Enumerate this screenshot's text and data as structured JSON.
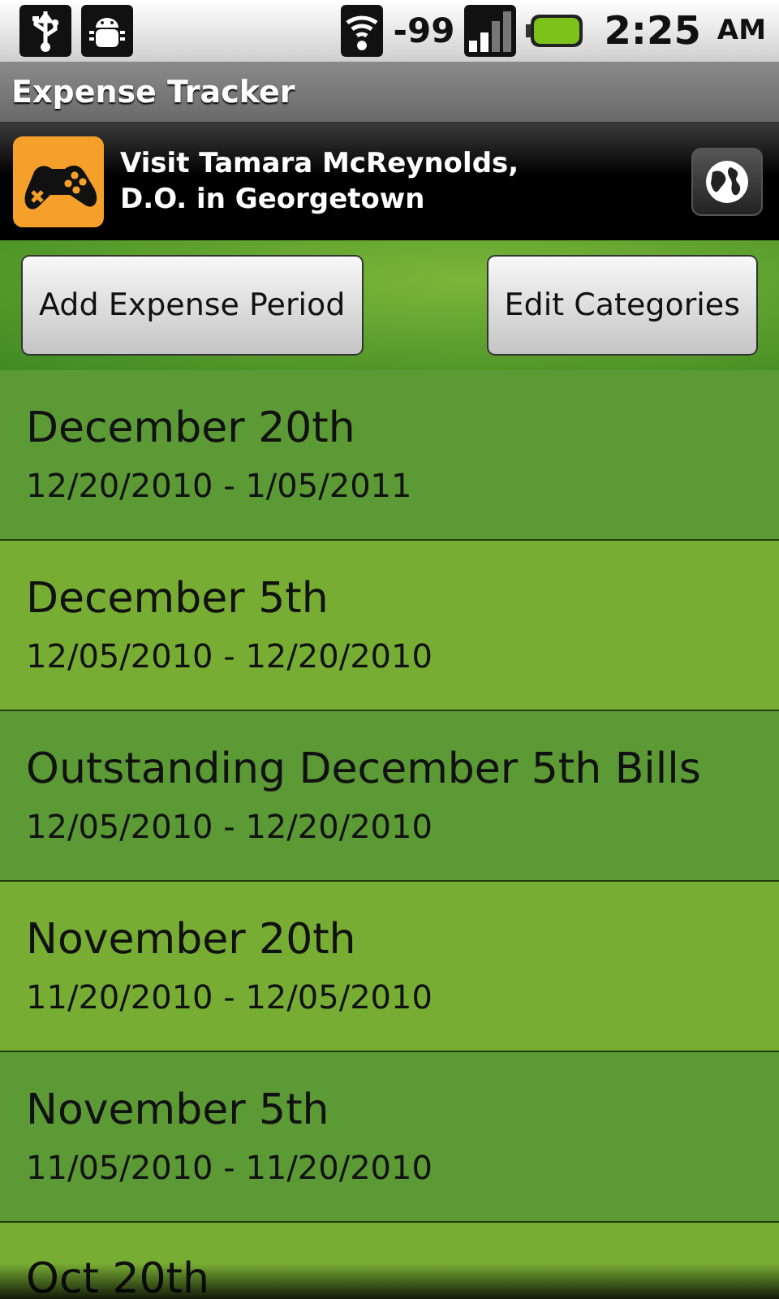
{
  "status_bar": {
    "signal_reading": "-99",
    "time": "2:25",
    "meridiem": "AM"
  },
  "title_bar": {
    "title": "Expense Tracker"
  },
  "ad": {
    "text": "Visit Tamara McReynolds,\nD.O. in Georgetown"
  },
  "buttons": [
    {
      "label": "Add Expense Period"
    },
    {
      "label": "Edit Categories"
    }
  ],
  "periods": [
    {
      "name": "December 20th",
      "range": "12/20/2010 - 1/05/2011"
    },
    {
      "name": "December 5th",
      "range": "12/05/2010 - 12/20/2010"
    },
    {
      "name": "Outstanding December 5th Bills",
      "range": "12/05/2010 - 12/20/2010"
    },
    {
      "name": "November 20th",
      "range": "11/20/2010 - 12/05/2010"
    },
    {
      "name": "November 5th",
      "range": "11/05/2010 - 11/20/2010"
    },
    {
      "name": "Oct 20th"
    }
  ]
}
